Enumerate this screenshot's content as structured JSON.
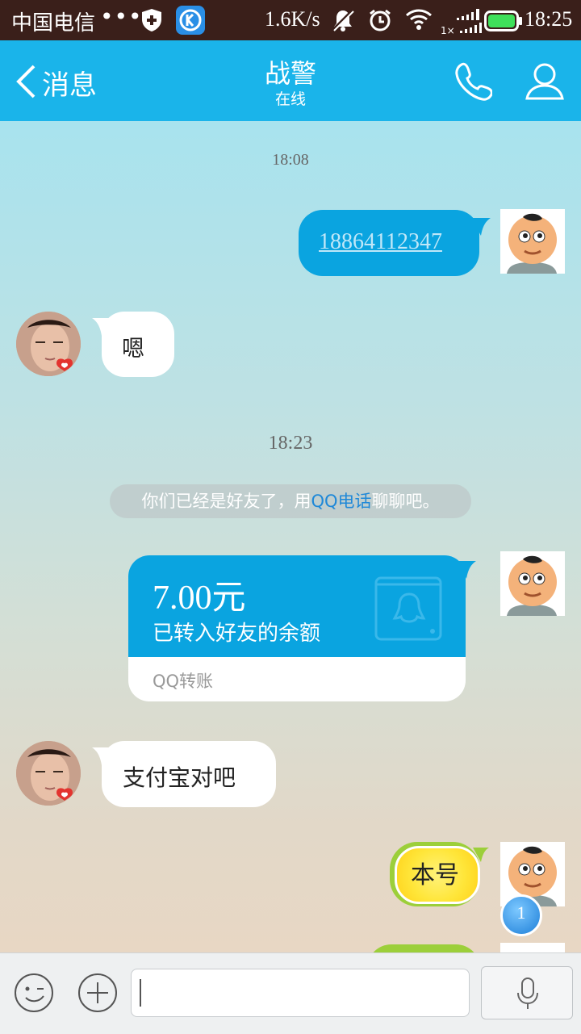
{
  "status_bar": {
    "carrier": "中国电信",
    "dots": "•••",
    "net_speed": "1.6K/s",
    "time": "18:25",
    "icons": [
      "shield-icon",
      "k-app-icon",
      "mute-icon",
      "alarm-icon",
      "wifi-icon",
      "signal-icon",
      "battery-icon"
    ],
    "signal_label": "1×"
  },
  "nav": {
    "back_label": "消息",
    "title": "战警",
    "subtitle": "在线"
  },
  "chat": {
    "timestamps": [
      "18:08",
      "18:23"
    ],
    "messages": {
      "phone_number": "18864112347",
      "friend_reply_1": "嗯",
      "friend_reply_2": "支付宝对吧",
      "lemon_text": "本号"
    },
    "system_message": {
      "prefix": "你们已经是好友了，用",
      "highlight": "QQ电话",
      "suffix": "聊聊吧。"
    },
    "transfer": {
      "amount": "7.00元",
      "description": "已转入好友的余额",
      "label": "QQ转账"
    },
    "unread_badge": "1"
  },
  "colors": {
    "nav_bg": "#1ab4ea",
    "bubble_blue": "#0aa4e0",
    "status_bar_bg": "#3a1f1a",
    "link_highlight": "#1e88d8"
  }
}
